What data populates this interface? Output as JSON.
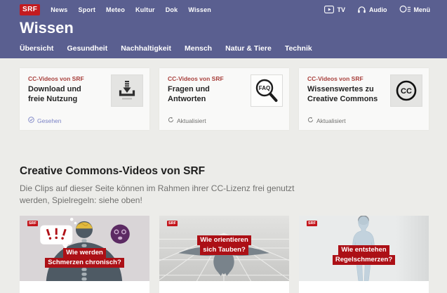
{
  "header": {
    "logo": "SRF",
    "nav": [
      "News",
      "Sport",
      "Meteo",
      "Kultur",
      "Dok",
      "Wissen"
    ],
    "actions": {
      "tv": "TV",
      "audio": "Audio",
      "menu": "Menü"
    },
    "title": "Wissen",
    "subnav": [
      "Übersicht",
      "Gesundheit",
      "Nachhaltigkeit",
      "Mensch",
      "Natur & Tiere",
      "Technik"
    ]
  },
  "cards": [
    {
      "kicker": "CC-Videos von SRF",
      "title": "Download und freie Nutzung",
      "icon": "download-icon",
      "status": "Gesehen"
    },
    {
      "kicker": "CC-Videos von SRF",
      "title": "Fragen und Antworten",
      "icon": "faq-magnifier-icon",
      "status": "Aktualisiert"
    },
    {
      "kicker": "CC-Videos von SRF",
      "title": "Wissenswertes zu Creative Commons",
      "icon": "creative-commons-icon",
      "status": "Aktualisiert"
    }
  ],
  "section": {
    "heading": "Creative Commons-Videos von SRF",
    "description": "Die Clips auf dieser Seite können im Rahmen ihrer CC-Lizenz frei genutzt werden, Spielregeln: siehe oben!"
  },
  "videos": [
    {
      "logo": "SRF",
      "line1": "Wie werden",
      "line2": "Schmerzen chronisch?"
    },
    {
      "logo": "SRF",
      "line1": "Wie orientieren",
      "line2": "sich Tauben?"
    },
    {
      "logo": "SRF",
      "line1": "Wie entstehen",
      "line2": "Regelschmerzen?"
    }
  ],
  "colors": {
    "header_purple": "#5a5f90",
    "srf_red": "#c31b20",
    "kicker_red": "#a8403c",
    "video_label_red": "#ac1016",
    "status_seen": "#7b83c6",
    "status_updated": "#70706e",
    "page_background": "#ecece9"
  }
}
